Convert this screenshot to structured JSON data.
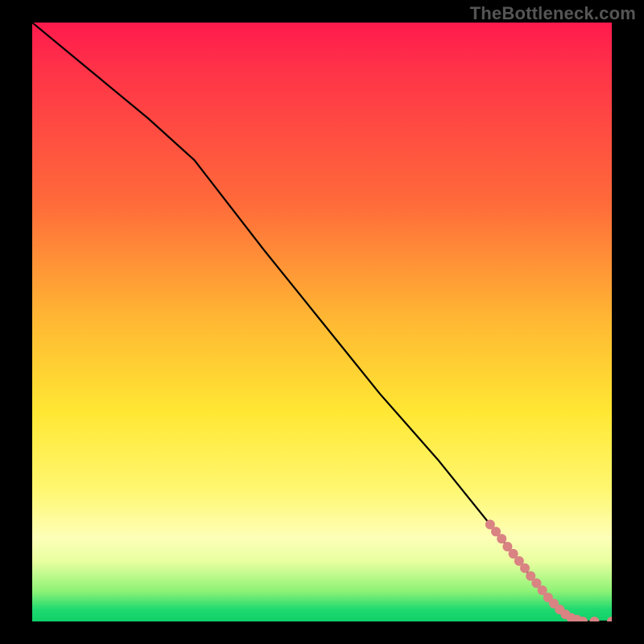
{
  "watermark": "TheBottleneck.com",
  "chart_data": {
    "type": "line",
    "title": "",
    "xlabel": "",
    "ylabel": "",
    "xlim": [
      0,
      100
    ],
    "ylim": [
      0,
      100
    ],
    "grid": false,
    "legend": false,
    "series": [
      {
        "name": "curve",
        "style": "line",
        "color": "#000000",
        "x": [
          0,
          10,
          20,
          28,
          40,
          50,
          60,
          70,
          80,
          88,
          92,
          95,
          97,
          100
        ],
        "y": [
          100,
          92,
          84,
          77,
          62,
          50,
          38,
          27,
          15,
          5,
          1,
          0,
          0,
          0
        ]
      },
      {
        "name": "markers",
        "style": "scatter",
        "color": "#d98383",
        "x": [
          79,
          80,
          81,
          82,
          83,
          84,
          85,
          86,
          87,
          88,
          89,
          90,
          91,
          92,
          93,
          94,
          95,
          97,
          100
        ],
        "y": [
          16.2,
          15.0,
          13.8,
          12.5,
          11.3,
          10.1,
          8.9,
          7.6,
          6.4,
          5.2,
          4.0,
          3.0,
          2.0,
          1.2,
          0.6,
          0.3,
          0.0,
          0.0,
          0.0
        ]
      }
    ],
    "background_gradient": {
      "direction": "vertical",
      "stops": [
        {
          "pos": 0.0,
          "color": "#ff1a4d"
        },
        {
          "pos": 0.3,
          "color": "#ff6a3a"
        },
        {
          "pos": 0.5,
          "color": "#ffb933"
        },
        {
          "pos": 0.65,
          "color": "#ffe733"
        },
        {
          "pos": 0.86,
          "color": "#fdffb8"
        },
        {
          "pos": 0.95,
          "color": "#8cf276"
        },
        {
          "pos": 1.0,
          "color": "#0fcf67"
        }
      ]
    }
  }
}
